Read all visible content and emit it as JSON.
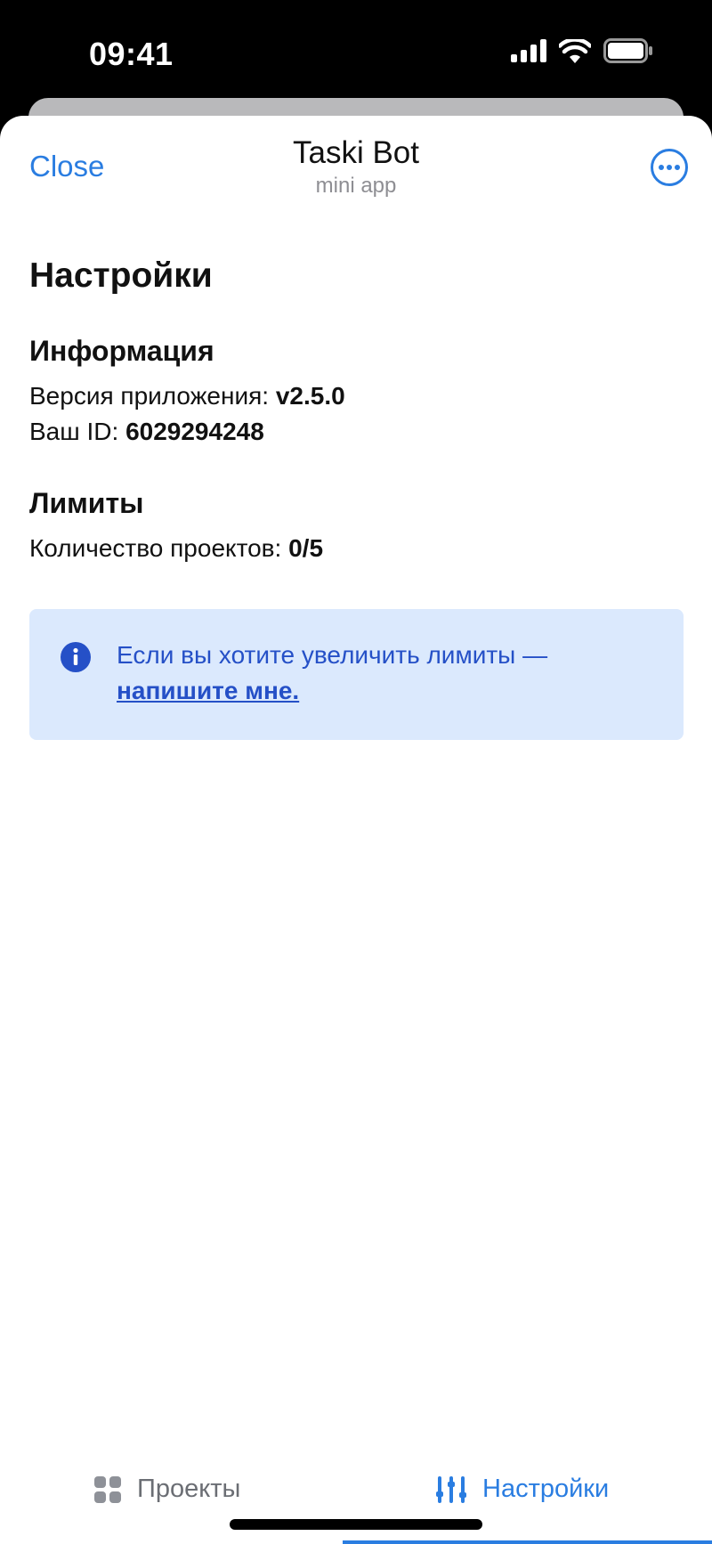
{
  "status": {
    "time": "09:41"
  },
  "nav": {
    "close": "Close",
    "title": "Taski Bot",
    "subtitle": "mini app"
  },
  "page": {
    "title": "Настройки"
  },
  "info": {
    "title": "Информация",
    "version_label": "Версия приложения:",
    "version_value": "v2.5.0",
    "id_label": "Ваш ID:",
    "id_value": "6029294248"
  },
  "limits": {
    "title": "Лимиты",
    "projects_label": "Количество проектов:",
    "projects_value": "0/5"
  },
  "notice": {
    "text": "Если вы хотите увеличить лимиты —",
    "link": "напишите мне."
  },
  "tabs": [
    {
      "label": "Проекты",
      "icon": "grid-icon",
      "active": false
    },
    {
      "label": "Настройки",
      "icon": "sliders-icon",
      "active": true
    }
  ],
  "colors": {
    "accent": "#2a7de1",
    "notice_bg": "#dbe9fd",
    "notice_text": "#2550c7"
  }
}
